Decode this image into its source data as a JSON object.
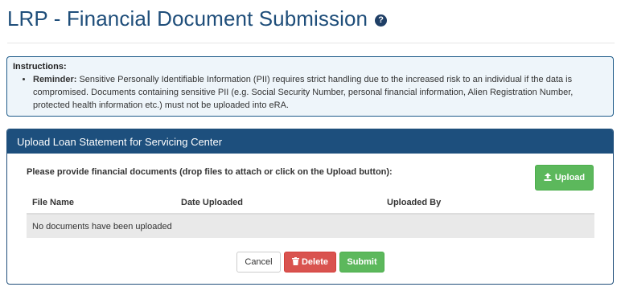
{
  "header": {
    "title": "LRP - Financial Document Submission",
    "help_icon": "?"
  },
  "instructions": {
    "heading": "Instructions:",
    "items": [
      {
        "label": "Reminder:",
        "text": " Sensitive Personally Identifiable Information (PII) requires strict handling due to the increased risk to an individual if the data is compromised. Documents containing sensitive PII (e.g. Social Security Number, personal financial information, Alien Registration Number, protected health information etc.) must not be uploaded into eRA."
      }
    ]
  },
  "panel": {
    "title": "Upload Loan Statement for  Servicing Center",
    "prompt": "Please provide financial documents (drop files to attach or click on the Upload button):",
    "upload_label": "Upload",
    "upload_icon": "upload-icon",
    "table": {
      "columns": [
        "File Name",
        "Date Uploaded",
        "Uploaded By"
      ],
      "empty_message": "No documents have been uploaded"
    },
    "buttons": {
      "cancel": "Cancel",
      "delete": "Delete",
      "submit": "Submit"
    }
  },
  "colors": {
    "title": "#1f4e7a",
    "panel_header": "#1d4f7d",
    "success": "#5cb85c",
    "danger": "#d9534f",
    "instructions_bg": "#eef5fa"
  }
}
